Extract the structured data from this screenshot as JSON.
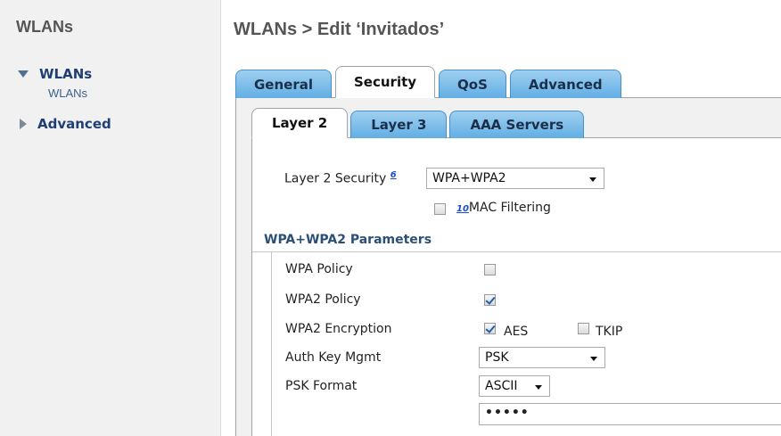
{
  "sidebar": {
    "title": "WLANs",
    "items": [
      {
        "label": "WLANs",
        "expanded": true,
        "children": [
          {
            "label": "WLANs"
          }
        ]
      },
      {
        "label": "Advanced",
        "expanded": false
      }
    ]
  },
  "page": {
    "title": "WLANs > Edit  ‘Invitados’"
  },
  "tabs": [
    {
      "label": "General",
      "active": false
    },
    {
      "label": "Security",
      "active": true
    },
    {
      "label": "QoS",
      "active": false
    },
    {
      "label": "Advanced",
      "active": false
    }
  ],
  "subtabs": [
    {
      "label": "Layer 2",
      "active": true
    },
    {
      "label": "Layer 3",
      "active": false
    },
    {
      "label": "AAA Servers",
      "active": false
    }
  ],
  "layer2": {
    "security_label": "Layer 2 Security",
    "security_footnote": "6",
    "security_value": "WPA+WPA2",
    "mac_filter_footnote": "10",
    "mac_filter_label": "MAC Filtering",
    "mac_filter_checked": false
  },
  "wpa": {
    "section_title": "WPA+WPA2 Parameters",
    "wpa_policy_label": "WPA Policy",
    "wpa_policy_checked": false,
    "wpa2_policy_label": "WPA2 Policy",
    "wpa2_policy_checked": true,
    "wpa2_encryption_label": "WPA2 Encryption",
    "aes_label": "AES",
    "aes_checked": true,
    "tkip_label": "TKIP",
    "tkip_checked": false,
    "auth_key_label": "Auth Key Mgmt",
    "auth_key_value": "PSK",
    "psk_format_label": "PSK Format",
    "psk_format_value": "ASCII",
    "psk_value": "•••••"
  },
  "colors": {
    "tab_blue": "#62aee4",
    "nav_text": "#1f3f73",
    "section_head": "#2c4f78"
  }
}
